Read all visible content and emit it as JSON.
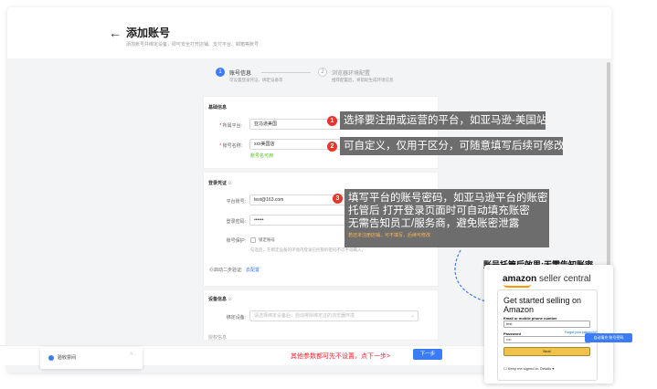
{
  "header": {
    "back_icon": "arrow-left-icon",
    "title": "添加账号",
    "subtitle": "添加账号并绑定设备，即可安全打开店铺、支付平台、邮箱等账号"
  },
  "steps": [
    {
      "number": "1",
      "label": "账号信息",
      "desc": "可设置登录凭证、绑定设备等",
      "active": true
    },
    {
      "number": "2",
      "label": "浏览器环境配置",
      "desc": "推荐配置后，将帮助生成环境信息",
      "active": false
    }
  ],
  "basic": {
    "section_title": "基础信息",
    "platform_label": "所属平台:",
    "platform_value": "亚马逊美国",
    "name_label": "账号名称:",
    "name_value": "xxx美国店",
    "name_ok": "账号名可用"
  },
  "login": {
    "section_title": "登录凭证",
    "account_label": "平台账号:",
    "account_value": "test@163.com",
    "password_label": "登录密码:",
    "password_value": "••••••",
    "protect_label": "账号保护:",
    "protect_option": "锁定账号",
    "protect_desc": "勾选后，在绑定设备的环境内登录已托管的密码不可手动输入。",
    "twofa_label": "⓪启动二步验证:",
    "twofa_link": "去配置"
  },
  "device": {
    "section_title": "设备信息",
    "bind_label": "绑定设备:",
    "bind_placeholder": "请选择绑定设备后，自动排除绑定过的浏览器环境"
  },
  "next_section": "授权信息",
  "bottom": {
    "hint": "其他参数都可先不设置，点下一步>",
    "next_label": "下一步",
    "verify_label": "验收票间",
    "verify_chevron": "^"
  },
  "callouts": {
    "c1_num": "1",
    "c1_text": "选择要注册或运营的平台，如亚马逊-美国站",
    "c2_num": "2",
    "c2_text": "可自定义，仅用于区分，可随意填写后续可修改",
    "c3_num": "3",
    "c3_lines": [
      "填写平台的账号密码，如亚马逊平台的账密",
      "托管后 打开登录页面时可自动填充账密",
      "无需告知员工/服务商，避免账密泄露"
    ],
    "c3_note": "若还未注册店铺，可不填写，后续可修改"
  },
  "effect": {
    "title": "账号托管后效果:无需告知账密",
    "logo_main": "amazon",
    "logo_sub": " seller central",
    "heading_line1": "Get started selling on",
    "heading_line2": "Amazon",
    "email_label": "Email or mobile phone number",
    "email_value": "test",
    "password_label": "Password",
    "forgot": "Forgot your password?",
    "password_value": "••••",
    "next_button": "Next",
    "keep": "☐ Keep me signed in. Details ▾",
    "autofill_button": "自动填充 账号密码"
  }
}
